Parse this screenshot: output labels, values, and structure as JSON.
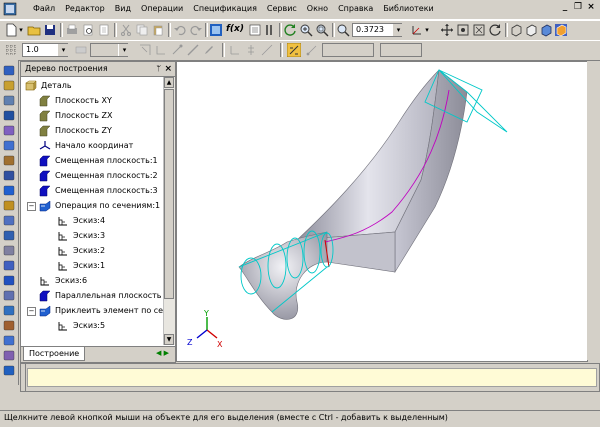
{
  "menu": {
    "items": [
      "Файл",
      "Редактор",
      "Вид",
      "Операции",
      "Спецификация",
      "Сервис",
      "Окно",
      "Справка",
      "Библиотеки"
    ]
  },
  "toolbar": {
    "zoom_value": "0.3723",
    "scale_value": "1.0",
    "fx_label": "f(x)"
  },
  "tree": {
    "title": "Дерево построения",
    "pin": "ᛘ",
    "close": "×",
    "tab_label": "Построение",
    "nodes": [
      {
        "label": "Деталь",
        "icon": "part-icon",
        "depth": 0
      },
      {
        "label": "Плоскость XY",
        "icon": "plane-icon",
        "depth": 1
      },
      {
        "label": "Плоскость ZX",
        "icon": "plane-icon",
        "depth": 1
      },
      {
        "label": "Плоскость ZY",
        "icon": "plane-icon",
        "depth": 1
      },
      {
        "label": "Начало координат",
        "icon": "origin-icon",
        "depth": 1
      },
      {
        "label": "Смещенная плоскость:1",
        "icon": "offset-plane-icon",
        "depth": 1
      },
      {
        "label": "Смещенная плоскость:2",
        "icon": "offset-plane-icon",
        "depth": 1
      },
      {
        "label": "Смещенная плоскость:3",
        "icon": "offset-plane-icon",
        "depth": 1
      },
      {
        "label": "Операция по сечениям:1",
        "icon": "loft-icon",
        "depth": 1,
        "expanded": true
      },
      {
        "label": "Эскиз:4",
        "icon": "sketch-icon",
        "depth": 2
      },
      {
        "label": "Эскиз:3",
        "icon": "sketch-icon",
        "depth": 2
      },
      {
        "label": "Эскиз:2",
        "icon": "sketch-icon",
        "depth": 2
      },
      {
        "label": "Эскиз:1",
        "icon": "sketch-icon",
        "depth": 2
      },
      {
        "label": "Эскиз:6",
        "icon": "sketch-icon",
        "depth": 1
      },
      {
        "label": "Параллельная плоскость",
        "icon": "offset-plane-icon",
        "depth": 1
      },
      {
        "label": "Приклеить элемент по сеч",
        "icon": "loft-icon",
        "depth": 1,
        "expanded": true
      },
      {
        "label": "Эскиз:5",
        "icon": "sketch-icon",
        "depth": 2
      }
    ]
  },
  "axes": {
    "x": "X",
    "y": "Y",
    "z": "Z"
  },
  "status": {
    "text": "Щелкните левой кнопкой мыши на объекте для его выделения (вместе с Ctrl - добавить к выделенным)"
  },
  "colors": {
    "accent": "#0a246a",
    "loft_edge": "#00c8c8",
    "curve": "#c000c0"
  }
}
